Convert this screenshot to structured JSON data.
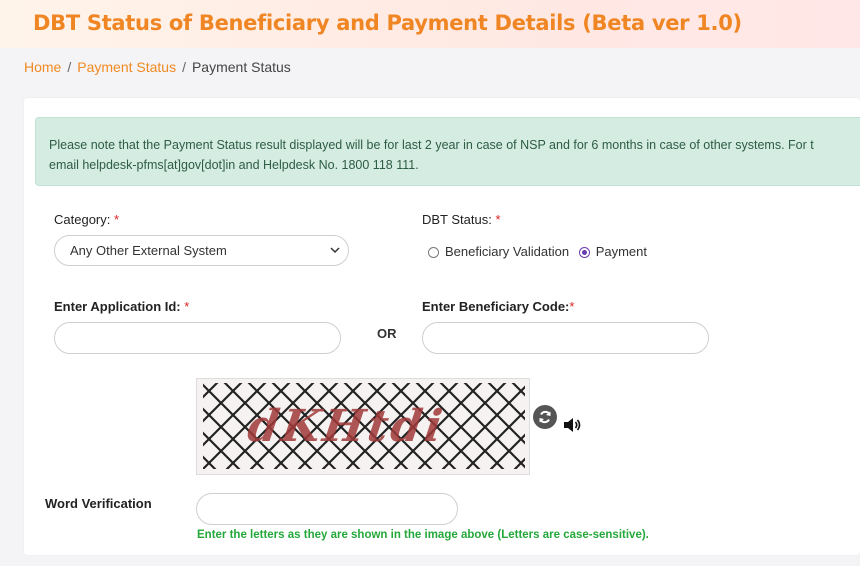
{
  "header": {
    "title": "DBT Status of Beneficiary and Payment Details (Beta ver 1.0)"
  },
  "breadcrumb": {
    "home": "Home",
    "payment_status_link": "Payment Status",
    "current": "Payment Status"
  },
  "notice": {
    "line1": "Please note that the Payment Status result displayed will be for last 2 year in case of NSP and for 6 months in case of other systems. For t",
    "line2": "email helpdesk-pfms[at]gov[dot]in and Helpdesk No. 1800 118 111."
  },
  "form": {
    "category_label": "Category:",
    "category_value": "Any Other External System",
    "dbt_status_label": "DBT Status:",
    "radio_beneficiary_validation": "Beneficiary Validation",
    "radio_payment": "Payment",
    "selected_radio": "Payment",
    "application_id_label": "Enter Application Id:",
    "application_id_value": "",
    "or_label": "OR",
    "beneficiary_code_label": "Enter Beneficiary Code:",
    "beneficiary_code_value": "",
    "required_mark": "*",
    "captcha_text": "dKHtdi",
    "word_verification_label": "Word Verification",
    "word_verification_value": "",
    "hint": "Enter the letters as they are shown in the image above (Letters are case-sensitive)."
  },
  "icons": {
    "refresh": "refresh-captcha-icon",
    "audio": "speaker-icon",
    "dropdown": "chevron-down-icon"
  },
  "colors": {
    "title": "#f08623",
    "link": "#f08a24",
    "notice_bg": "#d5ece2",
    "hint": "#24a83a",
    "required": "#dd2222",
    "radio_selected": "#6a3bb0"
  }
}
